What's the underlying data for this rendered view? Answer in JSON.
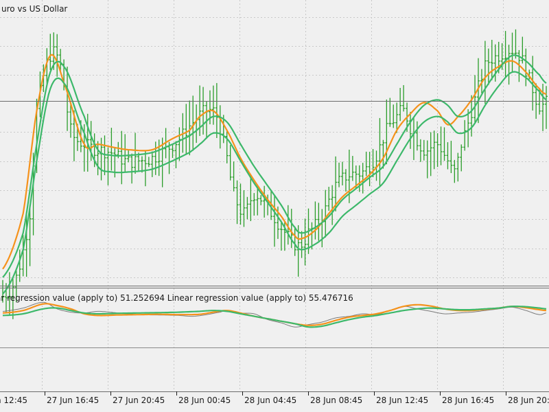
{
  "main_panel": {
    "title": "uro vs US Dollar"
  },
  "sub_panel": {
    "label": "ar regression value (apply to) 51.252694 Linear regression value (apply to) 55.476716"
  },
  "x_axis": {
    "labels": [
      "n 12:45",
      "27 Jun 16:45",
      "27 Jun 20:45",
      "28 Jun 00:45",
      "28 Jun 04:45",
      "28 Jun 08:45",
      "28 Jun 12:45",
      "28 Jun 16:45",
      "28 Jun 20:"
    ]
  },
  "colors": {
    "bars": "#2a9d2a",
    "fast_ma": "#f5921b",
    "slow_ma": "#3cb86a",
    "sub_raw": "#7a7a7a",
    "grid": "#c8c8c8",
    "separator": "#6b6b6b",
    "background": "#f0f0f0"
  },
  "chart_data": [
    {
      "type": "line",
      "panel": "main",
      "title": "uro vs US Dollar",
      "time_labels": [
        "n 12:45",
        "27 Jun 16:45",
        "27 Jun 20:45",
        "28 Jun 00:45",
        "28 Jun 04:45",
        "28 Jun 08:45",
        "28 Jun 12:45",
        "28 Jun 16:45",
        "28 Jun 20:"
      ],
      "series": [
        {
          "kind": "price_bars",
          "anchors": [
            [
              0,
              -0.05
            ],
            [
              4,
              0.02
            ],
            [
              8,
              0.25
            ],
            [
              10,
              0.62
            ],
            [
              14,
              0.82
            ],
            [
              17,
              0.78
            ],
            [
              20,
              0.55
            ],
            [
              24,
              0.5
            ],
            [
              28,
              0.48
            ],
            [
              32,
              0.47
            ],
            [
              36,
              0.44
            ],
            [
              40,
              0.44
            ],
            [
              44,
              0.45
            ],
            [
              48,
              0.48
            ],
            [
              52,
              0.52
            ],
            [
              56,
              0.58
            ],
            [
              60,
              0.62
            ],
            [
              63,
              0.6
            ],
            [
              66,
              0.45
            ],
            [
              68,
              0.32
            ],
            [
              71,
              0.25
            ],
            [
              74,
              0.32
            ],
            [
              78,
              0.27
            ],
            [
              82,
              0.2
            ],
            [
              86,
              0.14
            ],
            [
              88,
              0.14
            ],
            [
              90,
              0.18
            ],
            [
              94,
              0.24
            ],
            [
              98,
              0.35
            ],
            [
              102,
              0.39
            ],
            [
              106,
              0.4
            ],
            [
              110,
              0.46
            ],
            [
              113,
              0.55
            ],
            [
              116,
              0.6
            ],
            [
              118,
              0.62
            ],
            [
              120,
              0.56
            ],
            [
              124,
              0.48
            ],
            [
              128,
              0.5
            ],
            [
              131,
              0.44
            ],
            [
              133,
              0.4
            ],
            [
              135,
              0.5
            ],
            [
              138,
              0.62
            ],
            [
              142,
              0.78
            ],
            [
              146,
              0.82
            ],
            [
              150,
              0.84
            ],
            [
              153,
              0.8
            ],
            [
              156,
              0.7
            ],
            [
              158,
              0.64
            ],
            [
              160,
              0.65
            ]
          ]
        },
        {
          "kind": "ma_fast",
          "anchors": [
            [
              0,
              0.05
            ],
            [
              6,
              0.25
            ],
            [
              10,
              0.62
            ],
            [
              14,
              0.82
            ],
            [
              18,
              0.72
            ],
            [
              24,
              0.5
            ],
            [
              28,
              0.5
            ],
            [
              32,
              0.49
            ],
            [
              37,
              0.48
            ],
            [
              44,
              0.48
            ],
            [
              50,
              0.52
            ],
            [
              55,
              0.55
            ],
            [
              58,
              0.6
            ],
            [
              62,
              0.62
            ],
            [
              66,
              0.55
            ],
            [
              70,
              0.45
            ],
            [
              74,
              0.37
            ],
            [
              78,
              0.3
            ],
            [
              82,
              0.24
            ],
            [
              86,
              0.17
            ],
            [
              88,
              0.16
            ],
            [
              92,
              0.19
            ],
            [
              96,
              0.25
            ],
            [
              100,
              0.31
            ],
            [
              104,
              0.35
            ],
            [
              108,
              0.39
            ],
            [
              112,
              0.45
            ],
            [
              116,
              0.55
            ],
            [
              120,
              0.61
            ],
            [
              124,
              0.65
            ],
            [
              128,
              0.62
            ],
            [
              131,
              0.57
            ],
            [
              134,
              0.6
            ],
            [
              138,
              0.66
            ],
            [
              142,
              0.74
            ],
            [
              146,
              0.78
            ],
            [
              150,
              0.8
            ],
            [
              154,
              0.76
            ],
            [
              158,
              0.7
            ],
            [
              160,
              0.68
            ]
          ]
        },
        {
          "kind": "ma_slow",
          "anchors": [
            [
              0,
              0.02
            ],
            [
              6,
              0.18
            ],
            [
              10,
              0.5
            ],
            [
              14,
              0.76
            ],
            [
              18,
              0.78
            ],
            [
              24,
              0.6
            ],
            [
              28,
              0.48
            ],
            [
              32,
              0.46
            ],
            [
              37,
              0.46
            ],
            [
              44,
              0.47
            ],
            [
              50,
              0.5
            ],
            [
              55,
              0.53
            ],
            [
              58,
              0.56
            ],
            [
              62,
              0.6
            ],
            [
              66,
              0.58
            ],
            [
              70,
              0.5
            ],
            [
              74,
              0.42
            ],
            [
              78,
              0.35
            ],
            [
              82,
              0.28
            ],
            [
              86,
              0.2
            ],
            [
              88,
              0.18
            ],
            [
              92,
              0.2
            ],
            [
              96,
              0.24
            ],
            [
              100,
              0.3
            ],
            [
              104,
              0.34
            ],
            [
              108,
              0.38
            ],
            [
              112,
              0.42
            ],
            [
              116,
              0.5
            ],
            [
              120,
              0.58
            ],
            [
              124,
              0.64
            ],
            [
              128,
              0.66
            ],
            [
              131,
              0.64
            ],
            [
              134,
              0.6
            ],
            [
              138,
              0.62
            ],
            [
              142,
              0.7
            ],
            [
              146,
              0.77
            ],
            [
              150,
              0.82
            ],
            [
              154,
              0.8
            ],
            [
              158,
              0.75
            ],
            [
              160,
              0.72
            ]
          ]
        }
      ]
    },
    {
      "type": "line",
      "panel": "sub",
      "series": [
        {
          "kind": "raw",
          "anchors": [
            [
              0,
              0.4
            ],
            [
              6,
              0.6
            ],
            [
              12,
              0.95
            ],
            [
              16,
              0.55
            ],
            [
              20,
              0.35
            ],
            [
              24,
              0.3
            ],
            [
              28,
              0.4
            ],
            [
              34,
              0.3
            ],
            [
              40,
              0.2
            ],
            [
              46,
              0.18
            ],
            [
              52,
              0.15
            ],
            [
              56,
              0.1
            ],
            [
              60,
              0.2
            ],
            [
              64,
              0.35
            ],
            [
              66,
              0.45
            ],
            [
              70,
              0.3
            ],
            [
              74,
              0.25
            ],
            [
              78,
              -0.1
            ],
            [
              82,
              -0.3
            ],
            [
              86,
              -0.55
            ],
            [
              90,
              -0.4
            ],
            [
              94,
              -0.25
            ],
            [
              98,
              0.0
            ],
            [
              102,
              0.1
            ],
            [
              106,
              0.25
            ],
            [
              110,
              0.2
            ],
            [
              114,
              0.45
            ],
            [
              118,
              0.7
            ],
            [
              122,
              0.55
            ],
            [
              126,
              0.4
            ],
            [
              130,
              0.25
            ],
            [
              134,
              0.3
            ],
            [
              138,
              0.35
            ],
            [
              142,
              0.45
            ],
            [
              146,
              0.55
            ],
            [
              150,
              0.65
            ],
            [
              154,
              0.45
            ],
            [
              158,
              0.2
            ],
            [
              160,
              0.3
            ]
          ]
        },
        {
          "kind": "ma_fast",
          "anchors": [
            [
              0,
              0.3
            ],
            [
              6,
              0.45
            ],
            [
              12,
              0.85
            ],
            [
              16,
              0.75
            ],
            [
              20,
              0.55
            ],
            [
              24,
              0.25
            ],
            [
              28,
              0.15
            ],
            [
              34,
              0.18
            ],
            [
              40,
              0.2
            ],
            [
              46,
              0.22
            ],
            [
              52,
              0.2
            ],
            [
              58,
              0.22
            ],
            [
              62,
              0.35
            ],
            [
              66,
              0.45
            ],
            [
              70,
              0.3
            ],
            [
              74,
              0.1
            ],
            [
              78,
              -0.05
            ],
            [
              82,
              -0.2
            ],
            [
              86,
              -0.35
            ],
            [
              90,
              -0.45
            ],
            [
              94,
              -0.38
            ],
            [
              98,
              -0.15
            ],
            [
              102,
              0.05
            ],
            [
              106,
              0.15
            ],
            [
              110,
              0.25
            ],
            [
              114,
              0.45
            ],
            [
              118,
              0.7
            ],
            [
              122,
              0.8
            ],
            [
              126,
              0.72
            ],
            [
              130,
              0.55
            ],
            [
              134,
              0.45
            ],
            [
              138,
              0.45
            ],
            [
              142,
              0.52
            ],
            [
              146,
              0.6
            ],
            [
              150,
              0.7
            ],
            [
              154,
              0.62
            ],
            [
              158,
              0.5
            ],
            [
              160,
              0.45
            ]
          ]
        },
        {
          "kind": "ma_slow",
          "anchors": [
            [
              0,
              0.15
            ],
            [
              6,
              0.25
            ],
            [
              12,
              0.55
            ],
            [
              16,
              0.6
            ],
            [
              20,
              0.45
            ],
            [
              24,
              0.3
            ],
            [
              28,
              0.25
            ],
            [
              34,
              0.28
            ],
            [
              40,
              0.3
            ],
            [
              46,
              0.32
            ],
            [
              52,
              0.35
            ],
            [
              58,
              0.4
            ],
            [
              62,
              0.45
            ],
            [
              66,
              0.4
            ],
            [
              70,
              0.25
            ],
            [
              74,
              0.1
            ],
            [
              78,
              -0.05
            ],
            [
              82,
              -0.2
            ],
            [
              86,
              -0.35
            ],
            [
              90,
              -0.55
            ],
            [
              94,
              -0.5
            ],
            [
              98,
              -0.3
            ],
            [
              102,
              -0.1
            ],
            [
              106,
              0.05
            ],
            [
              110,
              0.15
            ],
            [
              114,
              0.3
            ],
            [
              118,
              0.45
            ],
            [
              122,
              0.55
            ],
            [
              126,
              0.6
            ],
            [
              130,
              0.55
            ],
            [
              134,
              0.5
            ],
            [
              138,
              0.5
            ],
            [
              142,
              0.55
            ],
            [
              146,
              0.6
            ],
            [
              150,
              0.7
            ],
            [
              154,
              0.68
            ],
            [
              158,
              0.6
            ],
            [
              160,
              0.55
            ]
          ]
        }
      ]
    }
  ]
}
